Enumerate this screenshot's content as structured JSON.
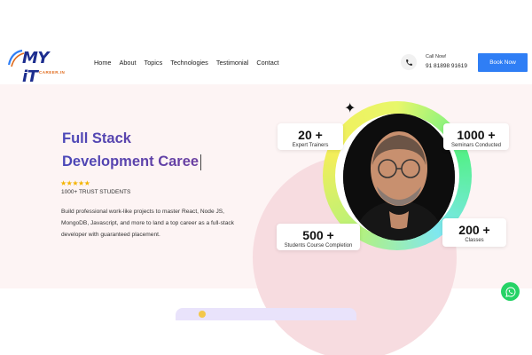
{
  "brand": {
    "logo_text": "MY iT",
    "logo_sub": "CAREER.IN"
  },
  "nav": {
    "items": [
      "Home",
      "About",
      "Topics",
      "Technologies",
      "Testimonial",
      "Contact"
    ]
  },
  "call": {
    "label": "Call Now!",
    "number": "91 81898 91619",
    "icon": "phone-icon"
  },
  "book_button": "Book Now",
  "hero": {
    "title_line1": "Full Stack",
    "title_line2": "Development Caree",
    "rating_stars": "★★★★★",
    "trust_text": "1000+ TRUST STUDENTS",
    "description": "Build professional work-like projects to master React, Node JS, MongoDB, Javascript, and more to land a top career as a full-stack developer with guaranteed placement.",
    "title_colors": {
      "start": "#4a47b8",
      "end": "#6b3fa0"
    }
  },
  "stats": [
    {
      "value": "20 +",
      "label": "Expert Trainers"
    },
    {
      "value": "1000 +",
      "label": "Seminars Conducted"
    },
    {
      "value": "500 +",
      "label": "Students Course Completion"
    },
    {
      "value": "200 +",
      "label": "Classes"
    }
  ],
  "colors": {
    "accent": "#2f7ef5",
    "hero_bg": "#fdf4f4",
    "whatsapp": "#25d366"
  }
}
